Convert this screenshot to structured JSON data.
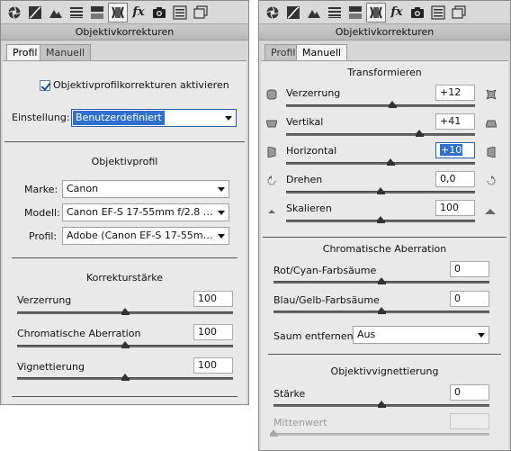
{
  "left": {
    "title": "Objektivkorrekturen",
    "tabs": [
      "Profil",
      "Manuell"
    ],
    "active_tab": "Profil",
    "enable_profile": {
      "label": "Objektivprofilkorrekturen aktivieren",
      "checked": true
    },
    "setting": {
      "label": "Einstellung:",
      "value": "Benutzerdefiniert"
    },
    "profile_section": {
      "title": "Objektivprofil",
      "make": {
        "label": "Marke:",
        "value": "Canon"
      },
      "model": {
        "label": "Modell:",
        "value": "Canon EF-S 17-55mm f/2.8 IS..."
      },
      "profile": {
        "label": "Profil:",
        "value": "Adobe (Canon EF-S 17-55mm ..."
      }
    },
    "strength_section": {
      "title": "Korrekturstärke",
      "sliders": [
        {
          "label": "Verzerrung",
          "value": "100",
          "fraction": 0.5
        },
        {
          "label": "Chromatische Aberration",
          "value": "100",
          "fraction": 0.5
        },
        {
          "label": "Vignettierung",
          "value": "100",
          "fraction": 0.5
        }
      ]
    }
  },
  "right": {
    "title": "Objektivkorrekturen",
    "tabs": [
      "Profil",
      "Manuell"
    ],
    "active_tab": "Manuell",
    "transform": {
      "title": "Transformieren",
      "sliders": [
        {
          "label": "Verzerrung",
          "value": "+12",
          "fraction": 0.56,
          "icon_left": "barrel-distortion-icon",
          "icon_right": "pincushion-distortion-icon"
        },
        {
          "label": "Vertikal",
          "value": "+41",
          "fraction": 0.705,
          "icon_left": "vertical-perspective-minus-icon",
          "icon_right": "vertical-perspective-plus-icon"
        },
        {
          "label": "Horizontal",
          "value": "+10",
          "fraction": 0.55,
          "icon_left": "horizontal-perspective-minus-icon",
          "icon_right": "horizontal-perspective-plus-icon",
          "highlighted": true
        },
        {
          "label": "Drehen",
          "value": "0,0",
          "fraction": 0.5,
          "icon_left": "rotate-ccw-icon",
          "icon_right": "rotate-cw-icon"
        },
        {
          "label": "Skalieren",
          "value": "100",
          "fraction": 0.5,
          "icon_left": "scale-down-icon",
          "icon_right": "scale-up-icon"
        }
      ]
    },
    "chromatic": {
      "title": "Chromatische Aberration",
      "sliders": [
        {
          "label": "Rot/Cyan-Farbsäume",
          "value": "0",
          "fraction": 0.5
        },
        {
          "label": "Blau/Gelb-Farbsäume",
          "value": "0",
          "fraction": 0.5
        }
      ],
      "defringe": {
        "label": "Saum entfernen:",
        "value": "Aus"
      }
    },
    "vignette": {
      "title": "Objektivvignettierung",
      "amount": {
        "label": "Stärke",
        "value": "0",
        "fraction": 0.5
      },
      "midpoint": {
        "label": "Mittenwert",
        "value": "",
        "fraction": 0.0,
        "disabled": true
      }
    }
  },
  "toolbar_icons": [
    "aperture-icon",
    "tone-curve-icon",
    "mountains-icon",
    "hsl-icon",
    "split-toning-icon",
    "lens-corrections-icon",
    "fx-icon",
    "camera-calibration-icon",
    "presets-icon",
    "snapshots-icon"
  ],
  "toolbar_fx_label": "fx"
}
